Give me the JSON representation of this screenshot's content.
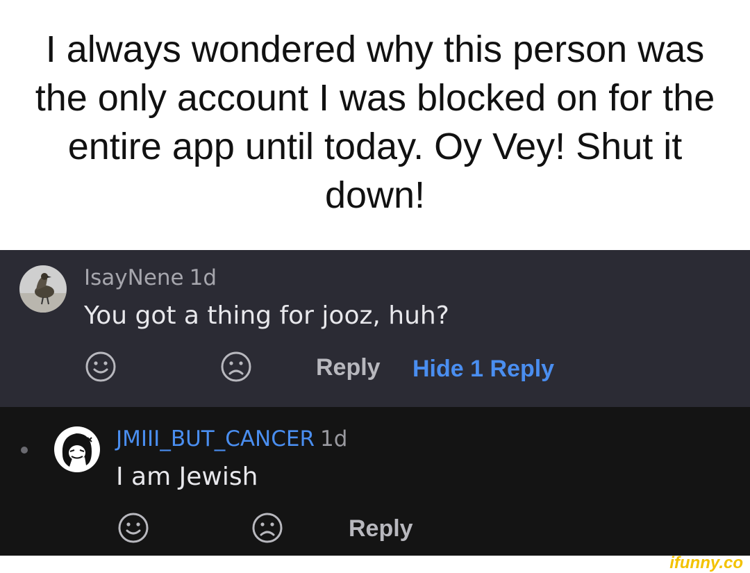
{
  "caption": {
    "text": "I always wondered why this person was the only account I was blocked on for the entire app until today. Oy Vey! Shut it down!"
  },
  "comment": {
    "username": "IsayNene",
    "time": "1d",
    "text": "You got a thing for jooz, huh?",
    "actions": {
      "smile_icon": "smile-icon",
      "frown_icon": "frown-icon",
      "reply_label": "Reply",
      "hide_replies_label": "Hide 1 Reply"
    }
  },
  "reply": {
    "username": "JMIII_BUT_CANCER",
    "time": "1d",
    "text": "I am Jewish",
    "actions": {
      "smile_icon": "smile-icon",
      "frown_icon": "frown-icon",
      "reply_label": "Reply"
    }
  },
  "watermark": {
    "text": "ifunny.co"
  },
  "colors": {
    "accent_blue": "#4a8ef0",
    "parent_bg": "#2b2b34",
    "child_bg": "#141414",
    "watermark": "#f3c200"
  }
}
